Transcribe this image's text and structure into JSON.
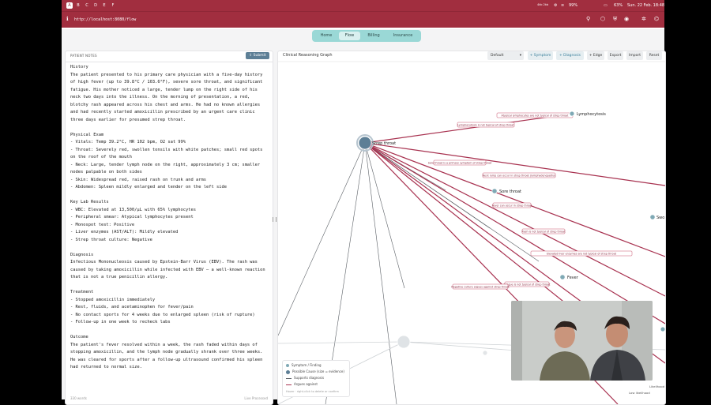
{
  "menubar": {
    "workspaces": [
      "A",
      "B",
      "C",
      "D",
      "E",
      "F"
    ],
    "network": "4kb 2kb",
    "battery_a": "99%",
    "battery_b": "63%",
    "datetime": "Sun. 22 Feb. 18:48"
  },
  "browser": {
    "url": "http://localhost:8080/flow"
  },
  "nav": {
    "tabs": [
      "Home",
      "Flow",
      "Billing",
      "Insurance"
    ],
    "active": "Flow"
  },
  "notes": {
    "header": "PATIENT NOTES",
    "submit_label": "Submit",
    "text": "History\nThe patient presented to his primary care physician with a five-day history of high fever (up to 39.8°C / 103.6°F), severe sore throat, and significant fatigue. His mother noticed a large, tender lump on the right side of his neck two days into the illness. On the morning of presentation, a red, blotchy rash appeared across his chest and arms. He had no known allergies and had recently started amoxicillin prescribed by an urgent care clinic three days earlier for presumed strep throat.\n\nPhysical Exam\n- Vitals: Temp 39.2°C, HR 102 bpm, O2 sat 99%\n- Throat: Severely red, swollen tonsils with white patches; small red spots on the roof of the mouth\n- Neck: Large, tender lymph node on the right, approximately 3 cm; smaller nodes palpable on both sides\n- Skin: Widespread red, raised rash on trunk and arms\n- Abdomen: Spleen mildly enlarged and tender on the left side\n\nKey Lab Results\n- WBC: Elevated at 13,500/μL with 65% lymphocytes\n- Peripheral smear: Atypical lymphocytes present\n- Monospot test: Positive\n- Liver enzymes (AST/ALT): Mildly elevated\n- Strep throat culture: Negative\n\nDiagnosis\nInfectious Mononucleosis caused by Epstein-Barr Virus (EBV). The rash was caused by taking amoxicillin while infected with EBV — a well-known reaction that is not a true penicillin allergy.\n\nTreatment\n- Stopped amoxicillin immediately\n- Rest, fluids, and acetaminophen for fever/pain\n- No contact sports for 4 weeks due to enlarged spleen (risk of rupture)\n- Follow-up in one week to recheck labs\n\nOutcome\nThe patient's fever resolved within a week, the rash faded within days of stopping amoxicillin, and the lymph node gradually shrank over three weeks. He was cleared for sports after a follow-up ultrasound confirmed his spleen had returned to normal size.",
    "word_count": "330 words",
    "status": "Live Processed"
  },
  "graph": {
    "title": "Clinical Reasoning Graph",
    "toolbar": {
      "select_value": "Default",
      "symptom": "+ Symptom",
      "diagnosis": "+ Diagnosis",
      "edge": "+ Edge",
      "export": "Export",
      "import": "Import",
      "reset": "Reset"
    },
    "nodes": {
      "strep": "Strep throat",
      "lymphocytosis": "Lymphocytosis",
      "sore_throat": "Sore throat",
      "swollen": "Swo",
      "fever": "Fever"
    },
    "edge_labels": [
      "Atypical lymphocytes are not typical of strep throat",
      "Lymphocytosis is not typical of strep throat",
      "Sore throat is a primary symptom of strep throat",
      "Neck lump can occur in strep throat (lymphadenopathy)",
      "Fever can occur in strep throat",
      "Rash is not typical of strep throat",
      "Elevated liver enzymes are not typical of strep throat",
      "Fatigue is not typical of strep throat",
      "Negative culture argues against strep throat"
    ],
    "legend": {
      "symptom": "Symptom / Finding",
      "cause": "Possible Cause (size = evidence)",
      "supports": "Supports diagnosis",
      "argues": "Argues against",
      "hint": "Hover · right-click to delete or confirm"
    },
    "likelihood_a": "Likelihood",
    "likelihood_b": "Low likelihood",
    "colors": {
      "edge_against": "#a83250",
      "edge_support": "#5b6066",
      "label_border": "#c8556e",
      "node_fill": "#7fa9b5",
      "node_big": "#5d7f96"
    }
  }
}
